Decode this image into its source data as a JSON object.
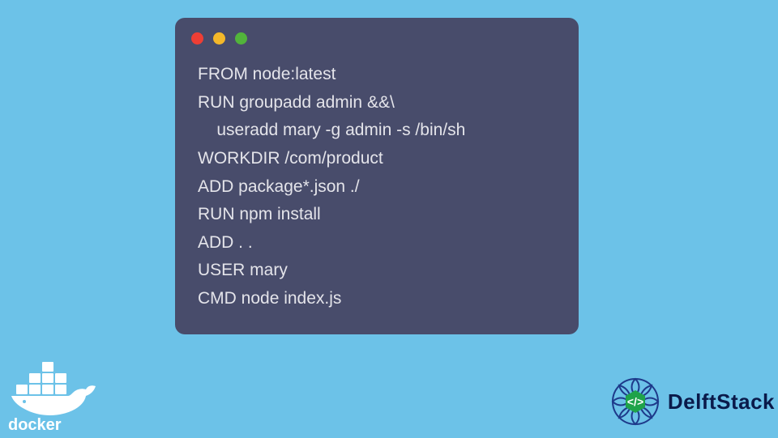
{
  "code": {
    "lines": [
      "FROM node:latest",
      "RUN groupadd admin &&\\",
      "    useradd mary -g admin -s /bin/sh",
      "WORKDIR /com/product",
      "ADD package*.json ./",
      "RUN npm install",
      "ADD . .",
      "USER mary",
      "CMD node index.js"
    ]
  },
  "traffic_lights": {
    "red": "#ee3e35",
    "yellow": "#f4b82a",
    "green": "#52b43b"
  },
  "logos": {
    "docker_label": "docker",
    "delftstack_label": "DelftStack"
  }
}
